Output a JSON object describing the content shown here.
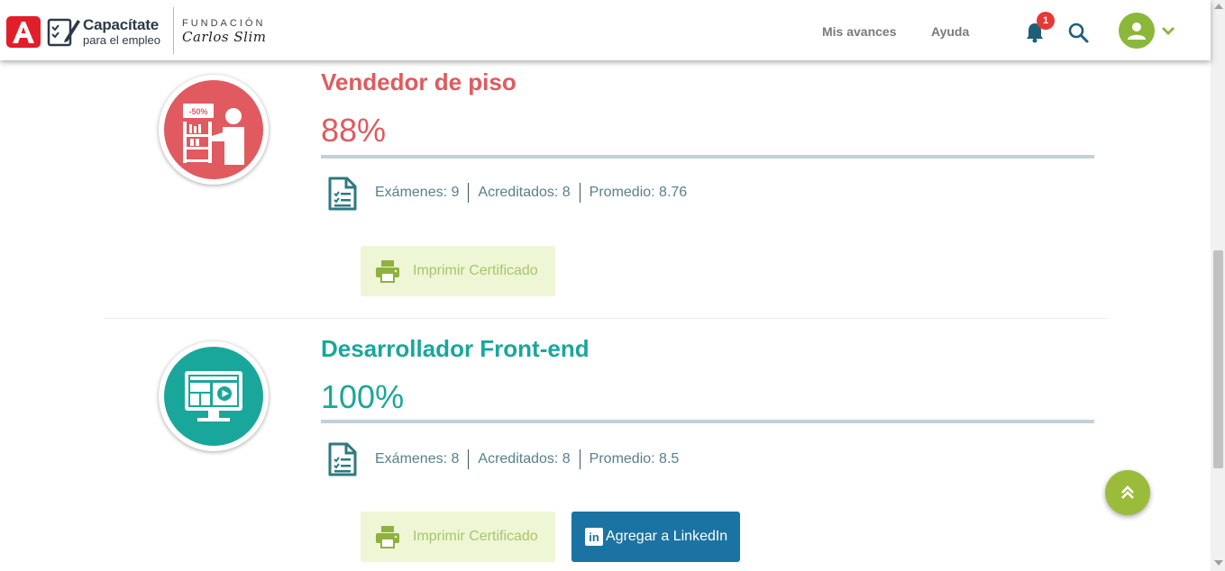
{
  "header": {
    "brand_line1": "Capacítate",
    "brand_line2": "para el empleo",
    "foundation_line1": "FUNDACIÓN",
    "foundation_line2": "Carlos Slim",
    "nav": [
      {
        "label": "Mis avances"
      },
      {
        "label": "Ayuda"
      }
    ],
    "notification_count": "1",
    "icons": {
      "bell": "bell-icon",
      "search": "search-icon",
      "avatar": "user-avatar-icon",
      "dropdown": "chevron-down-icon"
    }
  },
  "courses": [
    {
      "title": "Vendedor de piso",
      "percent": "88%",
      "color": "#e05a5f",
      "circle_color": "#e05a5f",
      "exams": "Exámenes: 9",
      "accredited": "Acreditados: 8",
      "average": "Promedio: 8.76",
      "print_label": "Imprimir Certificado",
      "badge_text": "-50%"
    },
    {
      "title": "Desarrollador Front-end",
      "percent": "100%",
      "color": "#1aa79b",
      "circle_color": "#1aa79b",
      "exams": "Exámenes: 8",
      "accredited": "Acreditados: 8",
      "average": "Promedio: 8.5",
      "print_label": "Imprimir Certificado",
      "linkedin_label": "Agregar a LinkedIn",
      "linkedin_logo": "in"
    }
  ],
  "colors": {
    "accent_green": "#8bb73a",
    "linkedin_blue": "#1a73a3",
    "brand_red": "#e11f2b"
  }
}
